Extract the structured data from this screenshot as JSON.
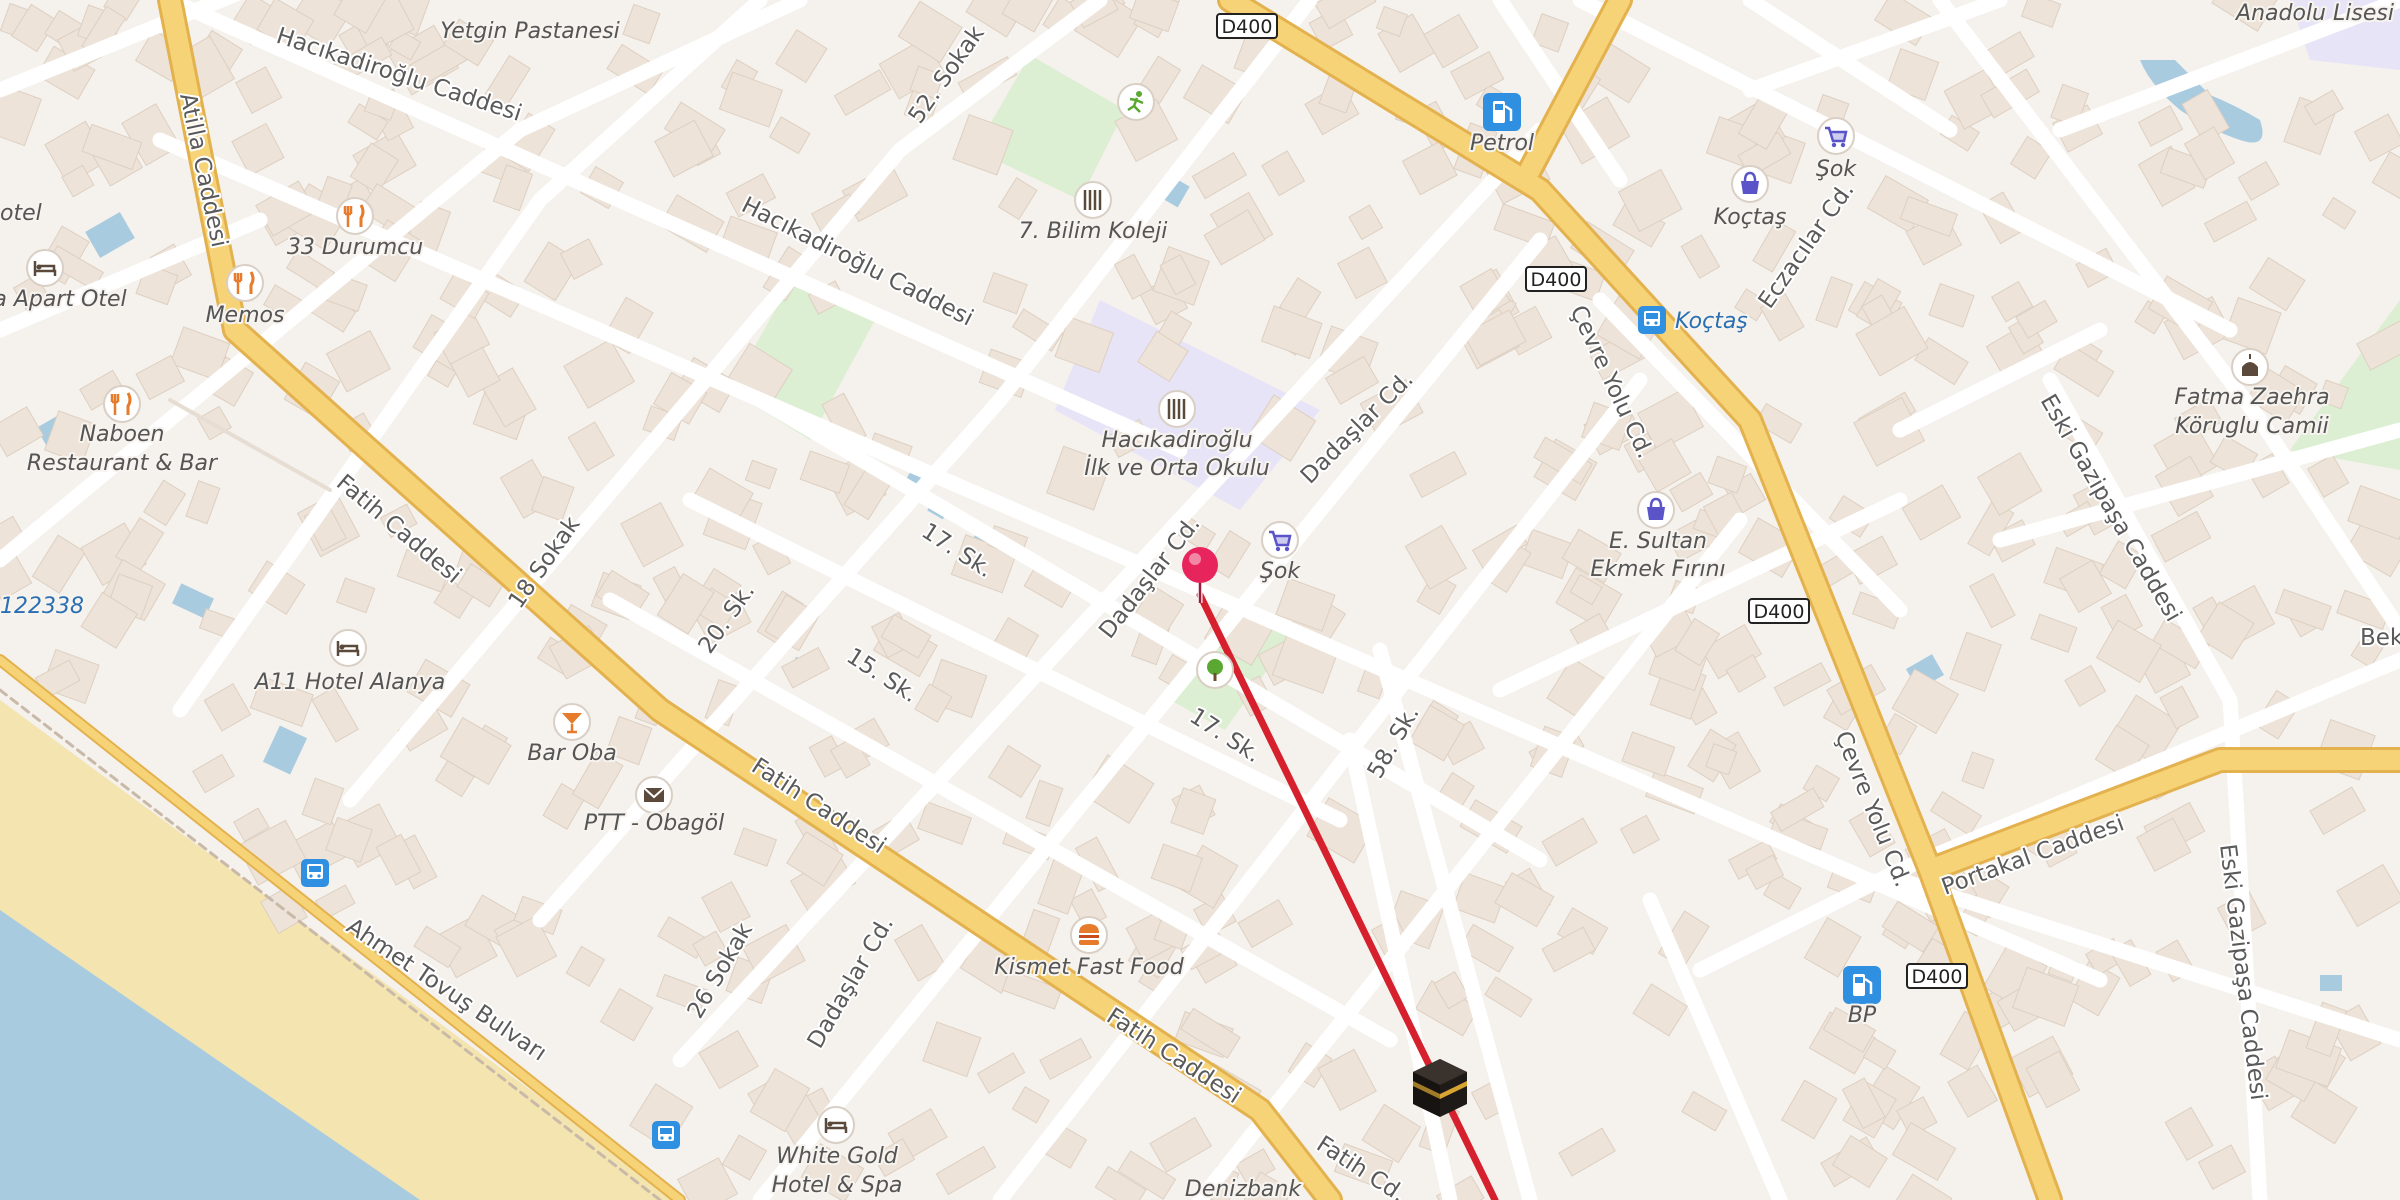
{
  "map": {
    "colors": {
      "background": "#f5f1ec",
      "building": "#ede3d8",
      "water": "#a9cbe0",
      "beach": "#f3e4b0",
      "park": "#dcefd2",
      "school": "#e8e4f7",
      "major_road": "#f6d376",
      "major_road_edge": "#e3b24f",
      "minor_road": "#ffffff",
      "route": "#d6202e",
      "pin": "#e8245c"
    },
    "route_shields": [
      {
        "name": "d400-shield-top",
        "text": "D400"
      },
      {
        "name": "d400-shield-mid",
        "text": "D400"
      },
      {
        "name": "d400-shield-right",
        "text": "D400"
      },
      {
        "name": "d400-shield-bottom",
        "text": "D400"
      }
    ],
    "streets": [
      {
        "name": "street-hacikadiroglu-1",
        "text": "Hacıkadiroğlu Caddesi"
      },
      {
        "name": "street-hacikadiroglu-2",
        "text": "Hacıkadiroğlu Caddesi"
      },
      {
        "name": "street-52-sokak",
        "text": "52. Sokak"
      },
      {
        "name": "street-atilla",
        "text": "Atilla Caddesi"
      },
      {
        "name": "street-fatih-1",
        "text": "Fatih Caddesi"
      },
      {
        "name": "street-fatih-2",
        "text": "Fatih Caddesi"
      },
      {
        "name": "street-fatih-3",
        "text": "Fatih Caddesi"
      },
      {
        "name": "street-fatih-4",
        "text": "Fatih Cd."
      },
      {
        "name": "street-18-sokak",
        "text": "18 Sokak"
      },
      {
        "name": "street-20-sk",
        "text": "20. Sk."
      },
      {
        "name": "street-15-sk",
        "text": "15. Sk."
      },
      {
        "name": "street-17-sk-1",
        "text": "17. Sk."
      },
      {
        "name": "street-17-sk-2",
        "text": "17. Sk."
      },
      {
        "name": "street-dadaslar-1",
        "text": "Dadaşlar Cd."
      },
      {
        "name": "street-dadaslar-2",
        "text": "Dadaşlar Cd."
      },
      {
        "name": "street-dadaslar-3",
        "text": "Dadaşlar Cd."
      },
      {
        "name": "street-58-sk",
        "text": "58. Sk."
      },
      {
        "name": "street-26-sokak",
        "text": "26 Sokak"
      },
      {
        "name": "street-ahmet-tovus",
        "text": "Ahmet Tovuş Bulvarı"
      },
      {
        "name": "street-cevre-yolu-1",
        "text": "Çevre Yolu Cd."
      },
      {
        "name": "street-cevre-yolu-2",
        "text": "Çevre Yolu Cd."
      },
      {
        "name": "street-eczacilar",
        "text": "Eczacılar Cd."
      },
      {
        "name": "street-eski-gazipasa-1",
        "text": "Eski Gazipaşa Caddesi"
      },
      {
        "name": "street-eski-gazipasa-2",
        "text": "Eski Gazipaşa Caddesi"
      },
      {
        "name": "street-portakal",
        "text": "Portakal Caddesi"
      },
      {
        "name": "street-bek",
        "text": "Bek"
      }
    ],
    "pois": [
      {
        "name": "poi-yetgin-pastanesi",
        "icon": "restaurant-icon",
        "lines": [
          "Yetgin Pastanesi"
        ]
      },
      {
        "name": "poi-33-durumcu",
        "icon": "restaurant-icon",
        "lines": [
          "33 Durumcu"
        ]
      },
      {
        "name": "poi-memos",
        "icon": "restaurant-icon",
        "lines": [
          "Memos"
        ]
      },
      {
        "name": "poi-naboen",
        "icon": "restaurant-icon",
        "lines": [
          "Naboen",
          "Restaurant & Bar"
        ]
      },
      {
        "name": "poi-apart-otel",
        "icon": "hotel-icon",
        "lines": [
          "a Apart Otel"
        ]
      },
      {
        "name": "poi-otel-edge",
        "icon": "none",
        "lines": [
          "otel"
        ]
      },
      {
        "name": "poi-7-bilim-koleji",
        "icon": "school-icon",
        "lines": [
          "7. Bilim Koleji"
        ]
      },
      {
        "name": "poi-hacikadiroglu-okulu",
        "icon": "school-icon",
        "lines": [
          "Hacıkadiroğlu",
          "İlk ve Orta Okulu"
        ]
      },
      {
        "name": "poi-petrol",
        "icon": "fuel-icon",
        "lines": [
          "Petrol"
        ]
      },
      {
        "name": "poi-sok-top",
        "icon": "cart-icon",
        "lines": [
          "Şok"
        ]
      },
      {
        "name": "poi-koctas-shop",
        "icon": "bag-icon",
        "lines": [
          "Koçtaş"
        ]
      },
      {
        "name": "poi-koctas-bus",
        "icon": "bus-icon",
        "lines": [
          "Koçtaş"
        ]
      },
      {
        "name": "poi-anadolu-lisesi",
        "icon": "none",
        "lines": [
          "Anadolu Lisesi"
        ]
      },
      {
        "name": "poi-fatma-zaehra",
        "icon": "mosque-icon",
        "lines": [
          "Fatma Zaehra",
          "Köruglu Camii"
        ]
      },
      {
        "name": "poi-e-sultan",
        "icon": "bag-icon",
        "lines": [
          "E. Sultan",
          "Ekmek Fırını"
        ]
      },
      {
        "name": "poi-sok-mid",
        "icon": "cart-icon",
        "lines": [
          "Şok"
        ]
      },
      {
        "name": "poi-a11-hotel",
        "icon": "hotel-icon",
        "lines": [
          "A11 Hotel Alanya"
        ]
      },
      {
        "name": "poi-bar-oba",
        "icon": "cocktail-icon",
        "lines": [
          "Bar Oba"
        ]
      },
      {
        "name": "poi-ptt",
        "icon": "mail-icon",
        "lines": [
          "PTT - Obagöl"
        ]
      },
      {
        "name": "poi-kismet",
        "icon": "burger-icon",
        "lines": [
          "Kismet Fast Food"
        ]
      },
      {
        "name": "poi-white-gold",
        "icon": "hotel-icon",
        "lines": [
          "White Gold",
          "Hotel & Spa"
        ]
      },
      {
        "name": "poi-denizbank",
        "icon": "none",
        "lines": [
          "Denizbank"
        ]
      },
      {
        "name": "poi-bp",
        "icon": "fuel-icon",
        "lines": [
          "BP"
        ]
      },
      {
        "name": "poi-122338",
        "icon": "none",
        "lines": [
          "122338"
        ]
      },
      {
        "name": "poi-park-tree",
        "icon": "tree-icon",
        "lines": []
      },
      {
        "name": "poi-sports",
        "icon": "running-icon",
        "lines": []
      },
      {
        "name": "poi-bus-left",
        "icon": "bus-icon",
        "lines": []
      },
      {
        "name": "poi-bus-bottom",
        "icon": "bus-icon",
        "lines": []
      }
    ],
    "markers": {
      "pin": "map-pin",
      "destination": "kaaba-icon"
    }
  }
}
